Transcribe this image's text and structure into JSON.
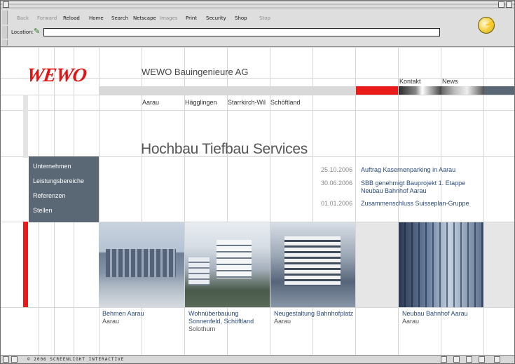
{
  "toolbar": {
    "back": "Back",
    "forward": "Forward",
    "reload": "Reload",
    "home": "Home",
    "search": "Search",
    "netscape": "Netscape",
    "images": "Images",
    "print": "Print",
    "security": "Security",
    "shop": "Shop",
    "stop": "Stop",
    "location_label": "Location:",
    "location_value": ""
  },
  "status": {
    "text": "© 2006 SCREENLIGHT INTERACTIVE"
  },
  "page": {
    "logo": "WEWO",
    "company": "WEWO Bauingenieure AG",
    "top_links": [
      "Kontakt",
      "News"
    ],
    "locations": [
      "Aarau",
      "Hägglingen",
      "Starrkirch-Wil",
      "Schöftland"
    ],
    "headline": "Hochbau Tiefbau Services",
    "menu": [
      "Unternehmen",
      "Leistungsbereiche",
      "Referenzen",
      "Stellen"
    ],
    "news": [
      {
        "date": "25.10.2006",
        "title": "Auftrag Kasernenparking in Aarau"
      },
      {
        "date": "30.06.2006",
        "title": "SBB genehmigt Bauprojekt 1. Etappe Neubau Bahnhof Aarau"
      },
      {
        "date": "01.01.2006",
        "title": "Zusammenschluss Suisseplan-Gruppe"
      }
    ],
    "projects": [
      {
        "title": "Behmen Aarau",
        "sub": "Aarau"
      },
      {
        "title": "Wohnüberbauung Sonnenfeld, Schöftland",
        "sub": "Solothurn"
      },
      {
        "title": "Neugestaltung Bahnhofplatz",
        "sub": "Aarau"
      },
      {
        "title": "Neubau Bahnhof Aarau",
        "sub": "Aarau"
      }
    ]
  },
  "colors": {
    "accent_red": "#ea1b1b",
    "slate": "#5a6774",
    "link_blue": "#2b4a7a"
  }
}
